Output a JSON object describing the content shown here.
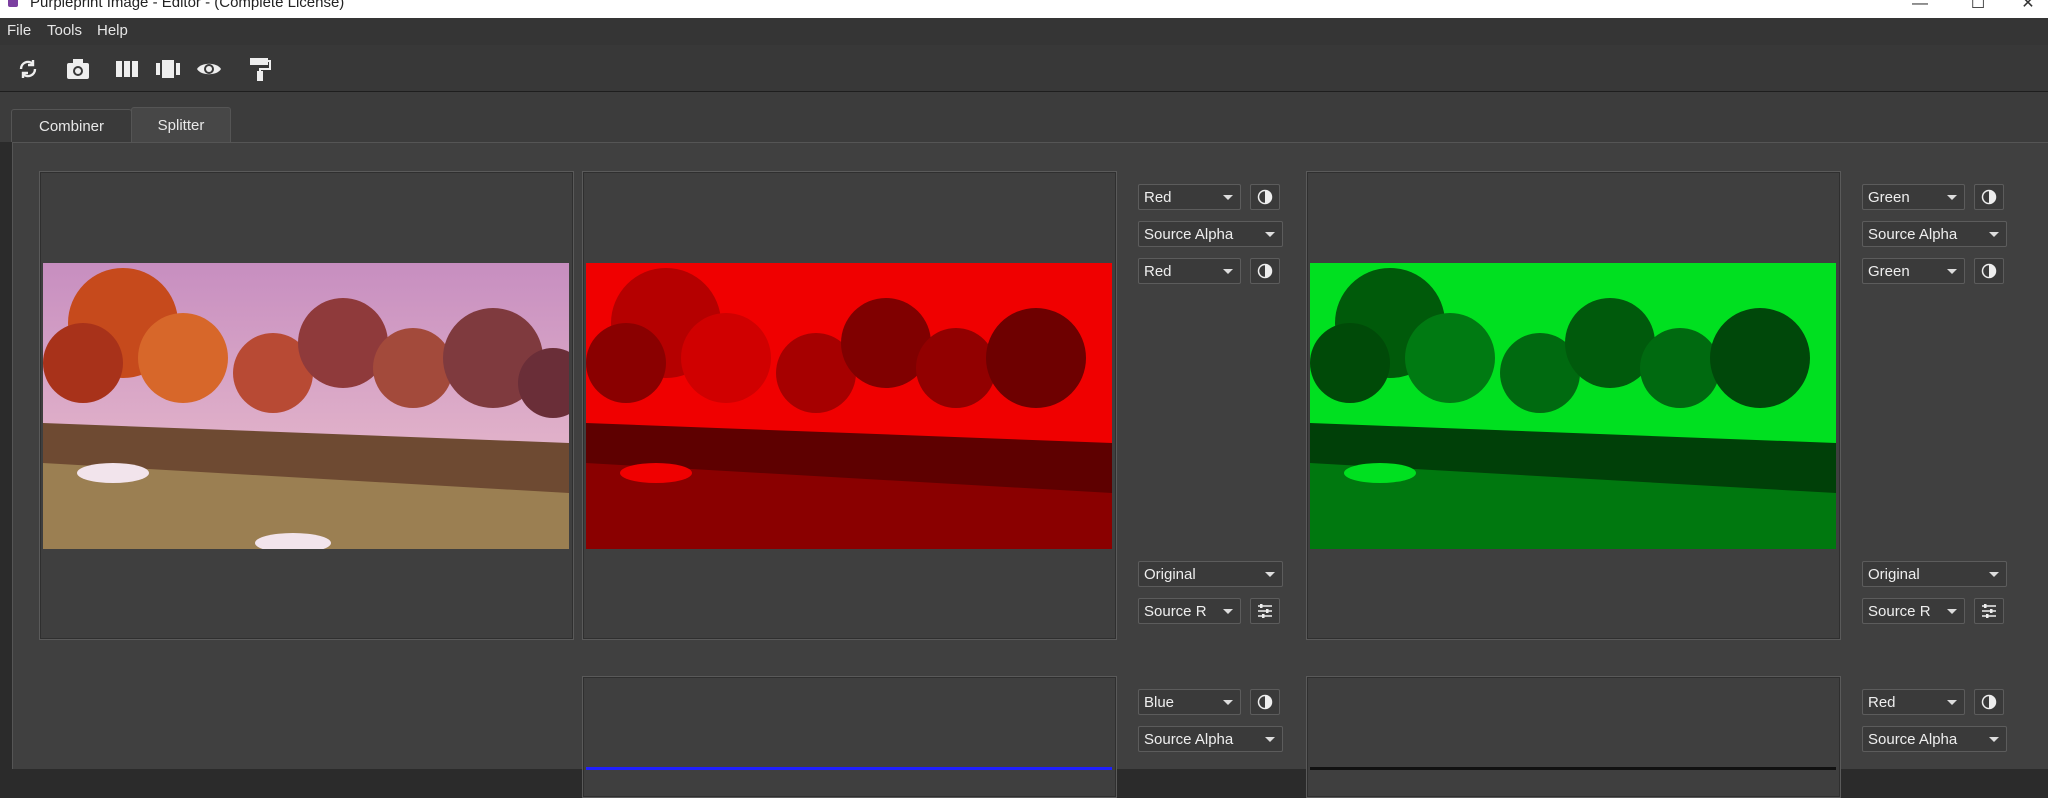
{
  "window": {
    "title": "Purpleprint Image - Editor - (Complete License)",
    "minimize_glyph": "—",
    "maximize_glyph": "☐",
    "close_glyph": "✕"
  },
  "menu": [
    "File",
    "Tools",
    "Help"
  ],
  "toolbar": {
    "icons": [
      "refresh-swap-icon",
      "camera-icon",
      "columns-icon",
      "film-strip-icon",
      "eye-icon",
      "paint-roller-icon"
    ]
  },
  "tabs": [
    {
      "label": "Combiner",
      "active": false
    },
    {
      "label": "Splitter",
      "active": true
    }
  ],
  "channels": [
    {
      "name": "red",
      "top_channel": "Red",
      "alpha": "Source Alpha",
      "mid_channel": "Red",
      "mode": "Original",
      "source": "Source R",
      "tint": "#ff0000"
    },
    {
      "name": "green",
      "top_channel": "Green",
      "alpha": "Source Alpha",
      "mid_channel": "Green",
      "mode": "Original",
      "source": "Source R",
      "tint": "#00ff2a"
    },
    {
      "name": "blue",
      "top_channel": "Blue",
      "alpha": "Source Alpha",
      "tint": "#2020ff"
    },
    {
      "name": "alpha",
      "top_channel": "Red",
      "alpha": "Source Alpha"
    }
  ],
  "colors": {
    "background": "#404040",
    "panel": "#3f3f3f",
    "text": "#e6e6e6",
    "brand": "#7b3fa0"
  }
}
